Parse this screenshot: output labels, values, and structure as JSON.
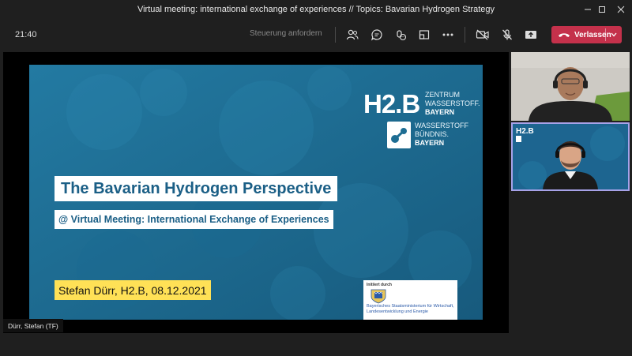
{
  "window": {
    "title": "Virtual meeting: international exchange of experiences // Topics: Bavarian Hydrogen Strategy"
  },
  "toolbar": {
    "timer": "21:40",
    "request_control_label": "Steuerung anfordern",
    "leave_label": "Verlassen",
    "icons": [
      "people-icon",
      "chat-icon",
      "reactions-icon",
      "rooms-icon",
      "more-icon",
      "camera-off-icon",
      "mic-off-icon",
      "share-icon"
    ]
  },
  "slide": {
    "logo_main": "H2.B",
    "logo_sub": [
      "ZENTRUM",
      "WASSERSTOFF.",
      "BAYERN"
    ],
    "alliance_sub": [
      "WASSERSTOFF",
      "BÜNDNIS.",
      "BAYERN"
    ],
    "title": "The Bavarian Hydrogen Perspective",
    "subtitle": "@ Virtual Meeting: International Exchange of Experiences",
    "presenter": "Stefan Dürr, H2.B, 08.12.2021",
    "initiative_intro": "Initiiert durch",
    "ministry": "Bayerisches Staatsministerium für Wirtschaft, Landesentwicklung und Energie"
  },
  "stage": {
    "presenter_name_tag": "Dürr, Stefan (TF)"
  },
  "colors": {
    "leave_button": "#c4314b",
    "slide_background": "#1e6d93",
    "presenter_highlight": "#ffe156",
    "active_speaker_border": "#a7a2e8"
  }
}
